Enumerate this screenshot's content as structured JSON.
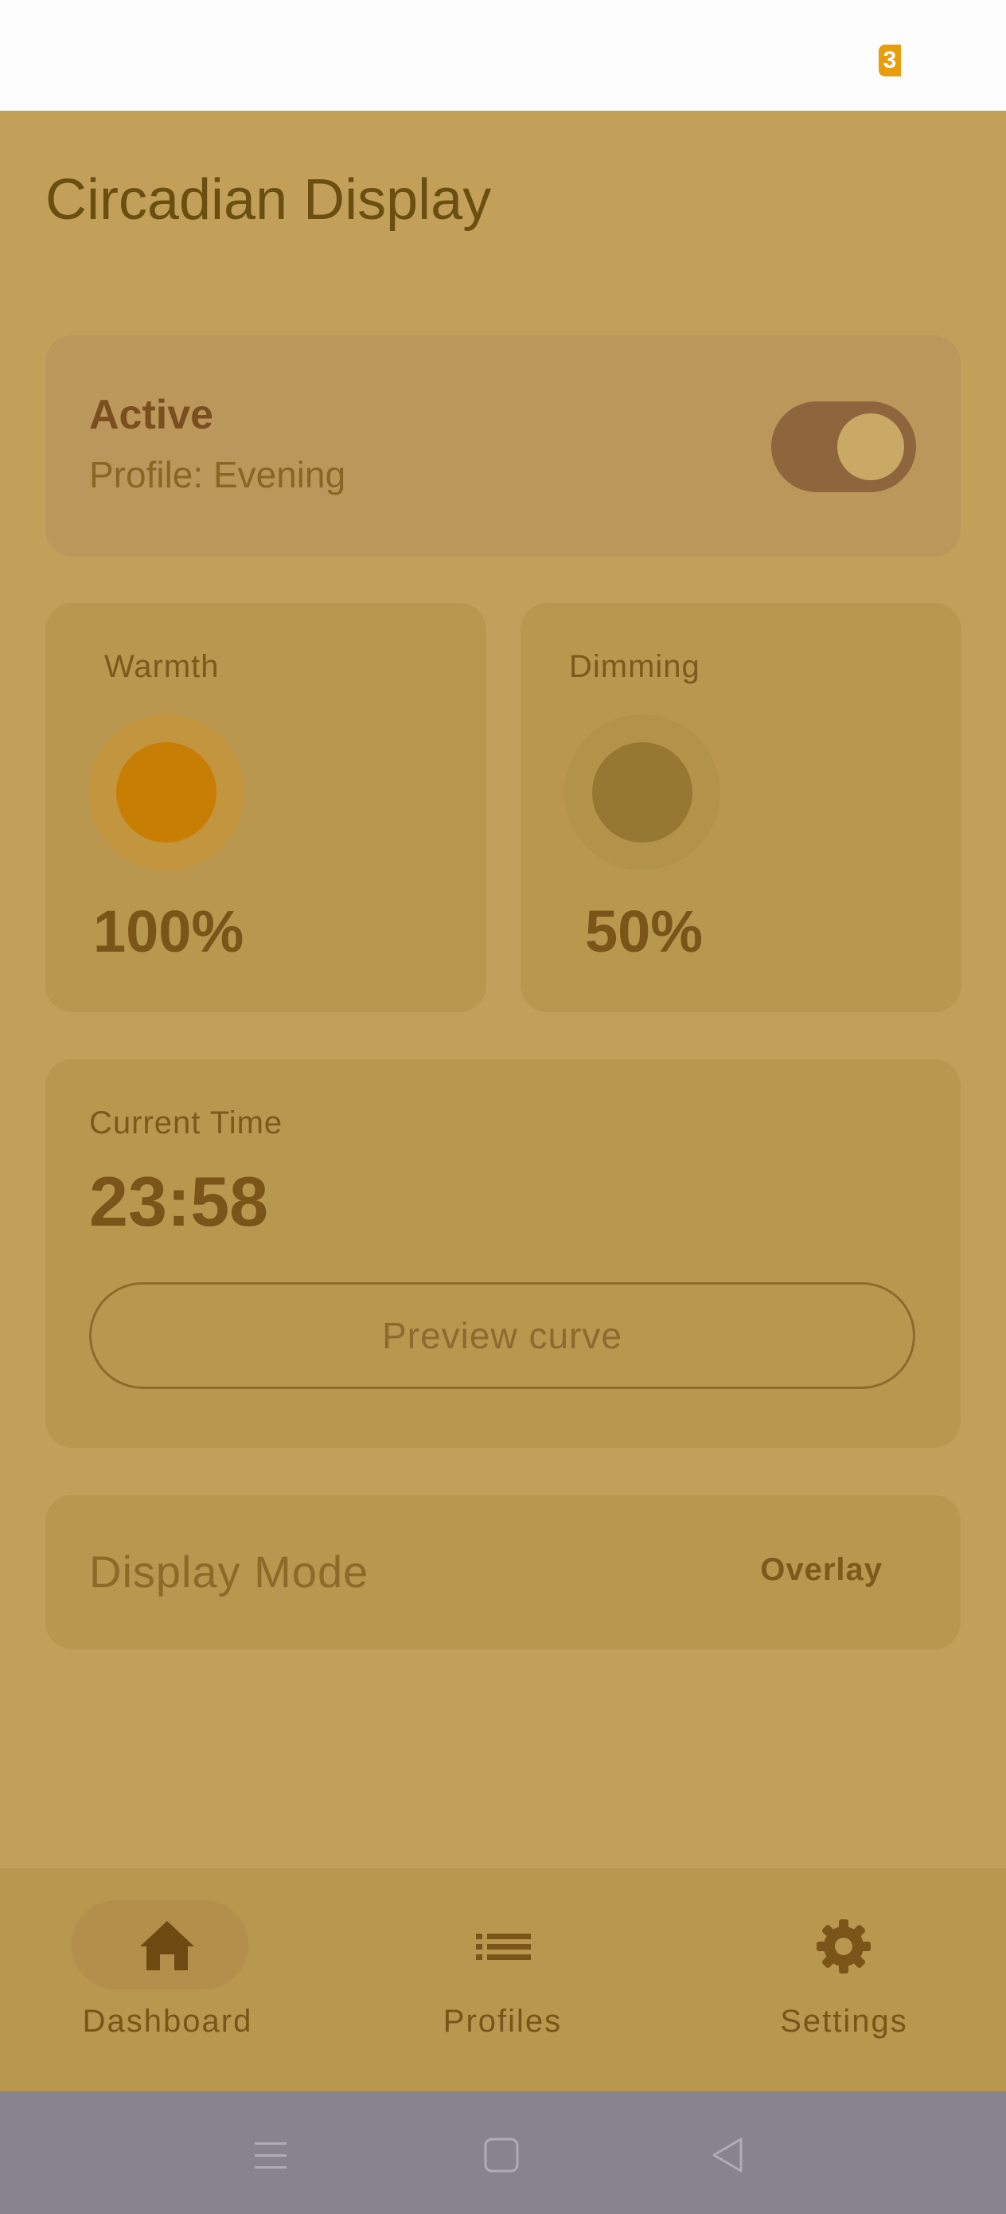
{
  "status_bar": {
    "battery_level": "3"
  },
  "app": {
    "title": "Circadian Display"
  },
  "active_card": {
    "title": "Active",
    "profile": "Profile: Evening",
    "enabled": true
  },
  "warmth": {
    "label": "Warmth",
    "value": "100%",
    "color": "#c87d05"
  },
  "dimming": {
    "label": "Dimming",
    "value": "50%",
    "color": "#967832"
  },
  "time_card": {
    "label": "Current Time",
    "value": "23:58",
    "button_label": "Preview curve"
  },
  "display_mode": {
    "label": "Display Mode",
    "value": "Overlay"
  },
  "bottom_nav": {
    "items": [
      {
        "label": "Dashboard",
        "icon": "home-icon",
        "selected": true
      },
      {
        "label": "Profiles",
        "icon": "list-icon",
        "selected": false
      },
      {
        "label": "Settings",
        "icon": "gear-icon",
        "selected": false
      }
    ]
  },
  "system_nav": {
    "icons": [
      "menu-icon",
      "home-square-icon",
      "back-triangle-icon"
    ]
  },
  "colors": {
    "background": "#c3a05a",
    "card": "#b9974f",
    "accent": "#c87d05",
    "battery": "#e79d0c"
  }
}
